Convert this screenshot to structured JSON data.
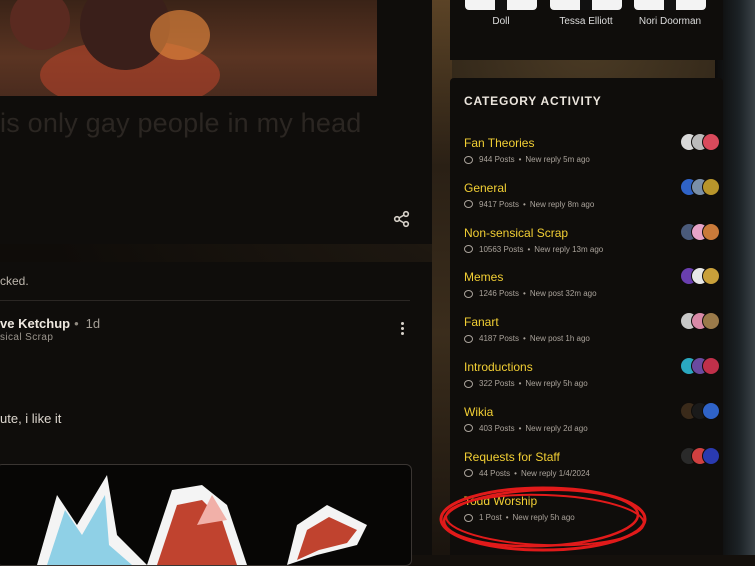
{
  "feed": {
    "post_caption": "is only gay people in my head",
    "locked_text": "cked.",
    "reply": {
      "author": "ve Ketchup",
      "time": "1d",
      "category": "sical Scrap",
      "text": "ute, i like it"
    }
  },
  "members": [
    {
      "name": "Doll"
    },
    {
      "name": "Tessa Elliott"
    },
    {
      "name": "Nori Doorman"
    }
  ],
  "category_activity": {
    "title": "CATEGORY ACTIVITY",
    "items": [
      {
        "name": "Fan Theories",
        "posts": "944 Posts",
        "activity": "New reply 5m ago",
        "avatar_colors": [
          "#d9d9d9",
          "#bbbbbb",
          "#d94a5c"
        ]
      },
      {
        "name": "General",
        "posts": "9417 Posts",
        "activity": "New reply 8m ago",
        "avatar_colors": [
          "#2f63c8",
          "#7a8fa8",
          "#b8952b"
        ]
      },
      {
        "name": "Non-sensical Scrap",
        "posts": "10563 Posts",
        "activity": "New reply 13m ago",
        "avatar_colors": [
          "#4a5a7a",
          "#e6a3c8",
          "#c97a3a"
        ]
      },
      {
        "name": "Memes",
        "posts": "1246 Posts",
        "activity": "New post 32m ago",
        "avatar_colors": [
          "#6a3fb0",
          "#e8e8e8",
          "#c9a03a"
        ]
      },
      {
        "name": "Fanart",
        "posts": "4187 Posts",
        "activity": "New post 1h ago",
        "avatar_colors": [
          "#c8c8c8",
          "#d98aa8",
          "#9a7a4a"
        ]
      },
      {
        "name": "Introductions",
        "posts": "322 Posts",
        "activity": "New reply 5h ago",
        "avatar_colors": [
          "#2aa8c0",
          "#6a4aa0",
          "#c0304a"
        ]
      },
      {
        "name": "Wikia",
        "posts": "403 Posts",
        "activity": "New reply 2d ago",
        "avatar_colors": [
          "#3a2a1a",
          "#1a1a1a",
          "#2f63c8"
        ]
      },
      {
        "name": "Requests for Staff",
        "posts": "44 Posts",
        "activity": "New reply 1/4/2024",
        "avatar_colors": [
          "#2a2a2a",
          "#d04040",
          "#2a3ab0"
        ]
      },
      {
        "name": "Todd Worship",
        "posts": "1 Post",
        "activity": "New reply 5h ago",
        "avatar_colors": []
      }
    ]
  },
  "colors": {
    "category_name": "#f2cf34",
    "highlight_ring": "#e11a1a"
  }
}
